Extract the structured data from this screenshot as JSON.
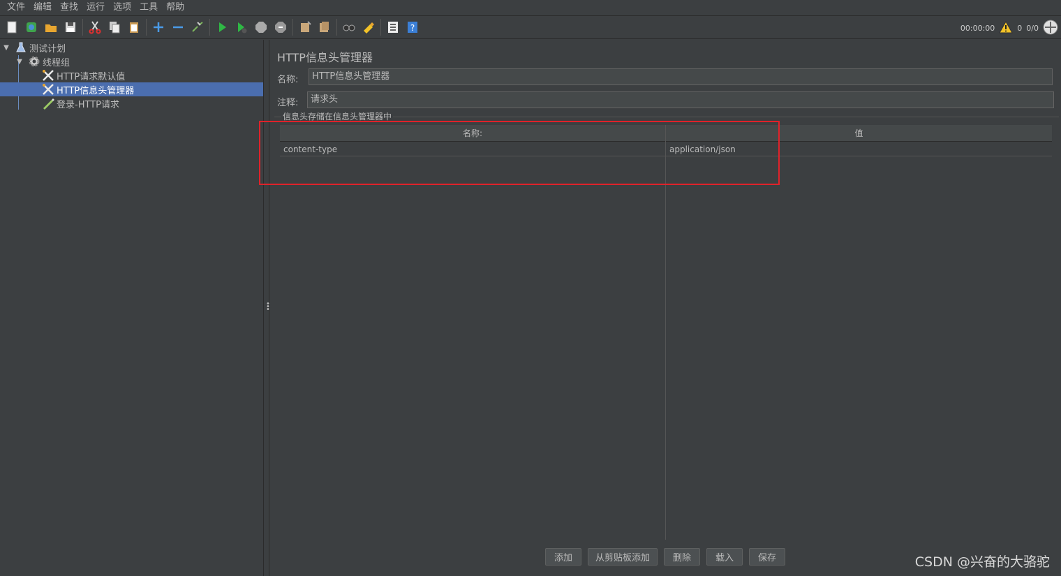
{
  "menu": [
    "文件",
    "编辑",
    "查找",
    "运行",
    "选项",
    "工具",
    "帮助"
  ],
  "toolbar": {
    "icons": [
      "new-icon",
      "templates-icon",
      "open-icon",
      "save-icon",
      "cut-icon",
      "copy-icon",
      "paste-icon",
      "expand-icon",
      "collapse-icon",
      "toggle-icon",
      "start-icon",
      "start-no-pause-icon",
      "stop-icon",
      "shutdown-icon",
      "clear-icon",
      "clear-all-icon",
      "search-icon",
      "reset-search-icon",
      "function-helper-icon",
      "help-icon"
    ],
    "timer": "00:00:00",
    "warning_count": "0",
    "threads": "0/0"
  },
  "tree": {
    "items": [
      {
        "label": "测试计划",
        "icon": "flask-icon",
        "level": 0,
        "expanded": true
      },
      {
        "label": "线程组",
        "icon": "gear-icon",
        "level": 1,
        "expanded": true
      },
      {
        "label": "HTTP请求默认值",
        "icon": "config-tools-icon",
        "level": 2
      },
      {
        "label": "HTTP信息头管理器",
        "icon": "config-tools-icon",
        "level": 2,
        "selected": true
      },
      {
        "label": "登录-HTTP请求",
        "icon": "sampler-pencil-icon",
        "level": 2
      }
    ]
  },
  "panel": {
    "title": "HTTP信息头管理器",
    "name_label": "名称:",
    "name_value": "HTTP信息头管理器",
    "comment_label": "注释:",
    "comment_value": "请求头",
    "group_title": "信息头存储在信息头管理器中",
    "table": {
      "headers": [
        "名称:",
        "值"
      ],
      "rows": [
        [
          "content-type",
          "application/json"
        ]
      ]
    },
    "buttons": [
      "添加",
      "从剪贴板添加",
      "删除",
      "载入",
      "保存"
    ]
  },
  "watermark": "CSDN @兴奋的大骆驼",
  "colors": {
    "background": "#3c3f41",
    "selection": "#4b6eaf",
    "highlight_box": "#e0222a"
  }
}
